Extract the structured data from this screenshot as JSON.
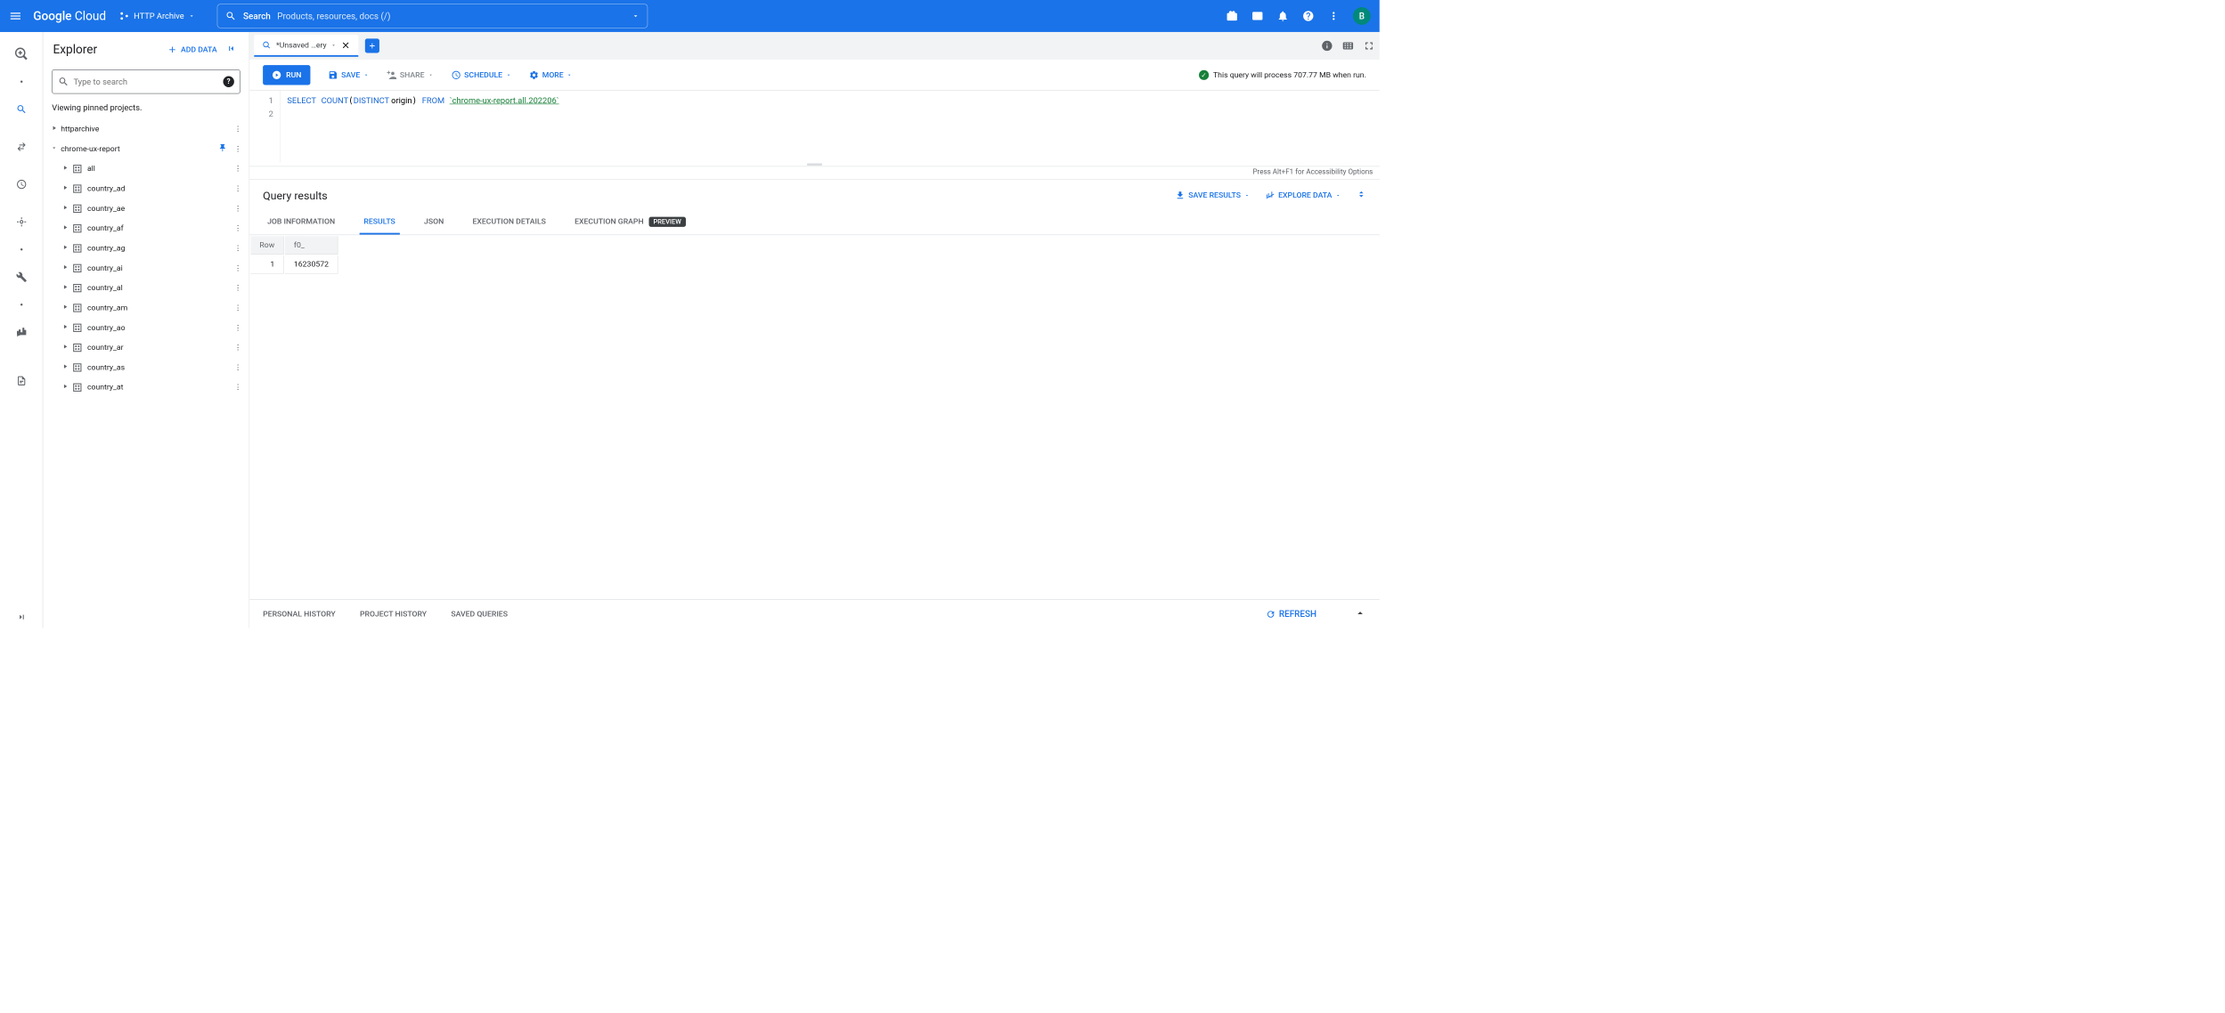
{
  "header": {
    "logo": "Google Cloud",
    "project": "HTTP Archive",
    "search_label": "Search",
    "search_placeholder": "Products, resources, docs (/)",
    "avatar_letter": "B"
  },
  "explorer": {
    "title": "Explorer",
    "add_data": "ADD DATA",
    "search_placeholder": "Type to search",
    "pinned_note": "Viewing pinned projects.",
    "projects": [
      {
        "name": "httparchive",
        "expanded": false,
        "pinned": false
      },
      {
        "name": "chrome-ux-report",
        "expanded": true,
        "pinned": true
      }
    ],
    "datasets": [
      "all",
      "country_ad",
      "country_ae",
      "country_af",
      "country_ag",
      "country_ai",
      "country_al",
      "country_am",
      "country_ao",
      "country_ar",
      "country_as",
      "country_at"
    ]
  },
  "tabs": {
    "active": "*Unsaved …ery"
  },
  "toolbar": {
    "run": "RUN",
    "save": "SAVE",
    "share": "SHARE",
    "schedule": "SCHEDULE",
    "more": "MORE",
    "validation": "This query will process 707.77 MB when run."
  },
  "editor": {
    "lines": [
      "1",
      "2"
    ],
    "sql_select": "SELECT",
    "sql_count": "COUNT",
    "sql_distinct": "DISTINCT",
    "sql_col": " origin",
    "sql_from": "FROM",
    "sql_table": "`chrome-ux-report.all.202206`",
    "a11y": "Press Alt+F1 for Accessibility Options"
  },
  "results": {
    "title": "Query results",
    "save_results": "SAVE RESULTS",
    "explore_data": "EXPLORE DATA",
    "tabs": {
      "job": "JOB INFORMATION",
      "results": "RESULTS",
      "json": "JSON",
      "exec_details": "EXECUTION DETAILS",
      "exec_graph": "EXECUTION GRAPH",
      "preview": "PREVIEW"
    },
    "columns": [
      "Row",
      "f0_"
    ],
    "rows": [
      {
        "row": "1",
        "f0": "16230572"
      }
    ]
  },
  "bottom": {
    "personal": "PERSONAL HISTORY",
    "project": "PROJECT HISTORY",
    "saved": "SAVED QUERIES",
    "refresh": "REFRESH"
  }
}
